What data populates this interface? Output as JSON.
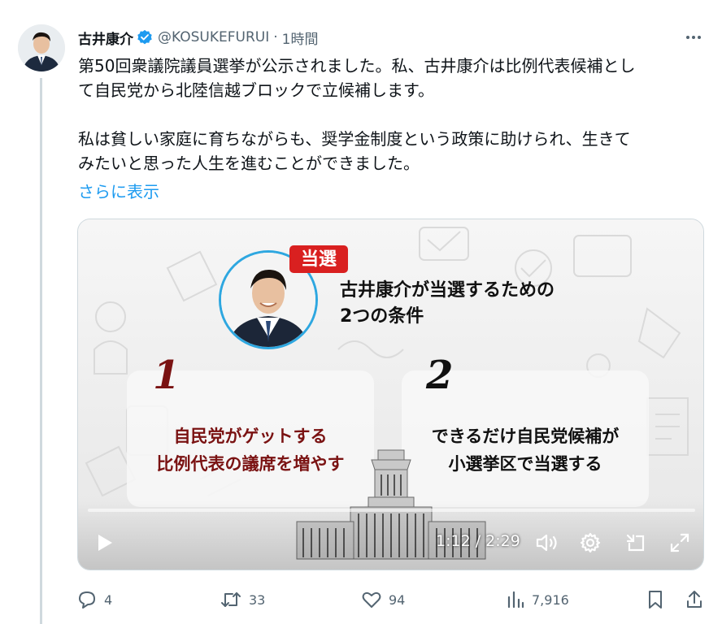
{
  "post": {
    "author_name": "古井康介",
    "handle": "@KOSUKEFURUI",
    "separator": "·",
    "time": "1時間",
    "paragraph1": "第50回衆議院議員選挙が公示されました。私、古井康介は比例代表候補とし\nて自民党から北陸信越ブロックで立候補します。",
    "paragraph2": "私は貧しい家庭に育ちながらも、奨学金制度という政策に助けられ、生きて\nみたいと思った人生を進むことができました。",
    "show_more": "さらに表示"
  },
  "media": {
    "badge": "当選",
    "heading_line1": "古井康介が当選するための",
    "heading_line2": "2つの条件",
    "condition1_number": "1",
    "condition1_line1": "自民党がゲットする",
    "condition1_line2": "比例代表の議席を増やす",
    "condition2_number": "2",
    "condition2_line1": "できるだけ自民党候補が",
    "condition2_line2": "小選挙区で当選する",
    "colors": {
      "badge": "#d92020",
      "condition1": "#7a1212",
      "portrait_ring": "#2ea7e0"
    }
  },
  "player": {
    "timecode": "1:12 / 2:29",
    "progress": 0.0,
    "icons": [
      "play-icon",
      "volume-icon",
      "settings-gear-icon",
      "dock-icon",
      "fullscreen-icon"
    ]
  },
  "actions": {
    "replies": "4",
    "reposts": "33",
    "likes": "94",
    "views": "7,916"
  },
  "colors": {
    "link": "#1d9bf0",
    "muted": "#536471",
    "verified": "#1d9bf0"
  }
}
